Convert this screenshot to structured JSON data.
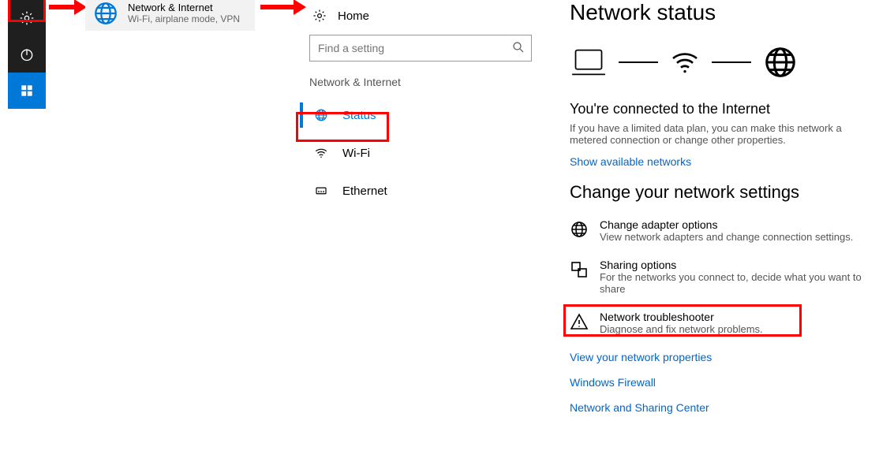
{
  "taskbar": {
    "items": [
      "settings",
      "power",
      "start"
    ]
  },
  "tile": {
    "title": "Network & Internet",
    "subtitle": "Wi-Fi, airplane mode, VPN"
  },
  "settings": {
    "home_label": "Home",
    "search_placeholder": "Find a setting",
    "category_header": "Network & Internet",
    "nav": [
      {
        "label": "Status",
        "icon": "globe",
        "active": true
      },
      {
        "label": "Wi-Fi",
        "icon": "wifi",
        "active": false
      },
      {
        "label": "Ethernet",
        "icon": "ethernet",
        "active": false
      }
    ]
  },
  "status": {
    "heading": "Network status",
    "connected_title": "You're connected to the Internet",
    "connected_body": "If you have a limited data plan, you can make this network a metered connection or change other properties.",
    "show_networks_link": "Show available networks",
    "change_heading": "Change your network settings",
    "options": [
      {
        "title": "Change adapter options",
        "sub": "View network adapters and change connection settings.",
        "icon": "globe"
      },
      {
        "title": "Sharing options",
        "sub": "For the networks you connect to, decide what you want to share",
        "icon": "share"
      },
      {
        "title": "Network troubleshooter",
        "sub": "Diagnose and fix network problems.",
        "icon": "warning",
        "highlighted": true
      }
    ],
    "links": [
      "View your network properties",
      "Windows Firewall",
      "Network and Sharing Center"
    ]
  }
}
